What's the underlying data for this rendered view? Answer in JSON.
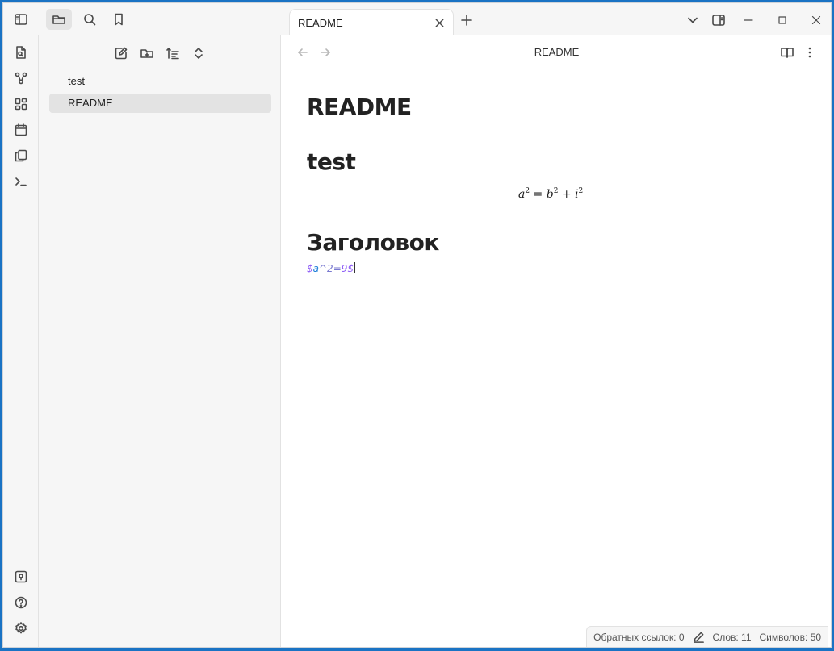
{
  "left_header": {
    "toggle_icon": "sidebar-toggle-icon",
    "tabs": [
      {
        "icon": "folder-icon",
        "active": true
      },
      {
        "icon": "search-icon",
        "active": false
      },
      {
        "icon": "bookmark-icon",
        "active": false
      }
    ]
  },
  "ribbon": {
    "top": [
      "file-search-icon",
      "graph-icon",
      "canvas-icon",
      "calendar-icon",
      "copy-icon",
      "terminal-icon"
    ],
    "bottom": [
      "vault-icon",
      "help-icon",
      "settings-icon"
    ]
  },
  "sidebar": {
    "toolbar": [
      "new-note-icon",
      "new-folder-icon",
      "sort-icon",
      "collapse-icon"
    ],
    "items": [
      {
        "label": "test",
        "active": false
      },
      {
        "label": "README",
        "active": true
      }
    ]
  },
  "tabbar": {
    "tab_title": "README"
  },
  "view": {
    "title": "README"
  },
  "document": {
    "h1_title": "README",
    "h1_test": "test",
    "math_block": "a² = b² + i²",
    "h1_heading": "Заголовок",
    "inline_math_source": "$a^2=9$"
  },
  "status": {
    "backlinks": "Обратных ссылок: 0",
    "words": "Слов: 11",
    "chars": "Символов: 50"
  }
}
